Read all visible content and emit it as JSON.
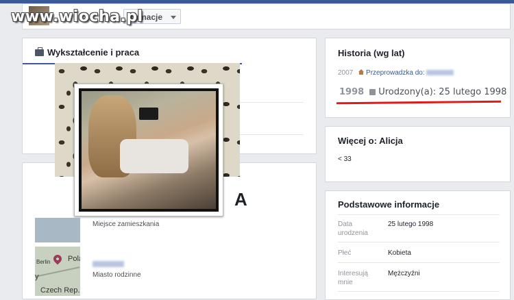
{
  "watermark": "www.wiocha.pl",
  "topbar": {
    "dropdown_label": "formacje"
  },
  "education": {
    "title": "Wykształcenie i praca",
    "overlay_letter": "A"
  },
  "places": [
    {
      "label": "Miejsce zamieszkania"
    },
    {
      "label": "Miasto rodzinne"
    }
  ],
  "map": {
    "label_berlin": "Berlin",
    "label_pola": "Pola",
    "label_y": "y",
    "label_czech": "Czech Rep."
  },
  "history": {
    "title": "Historia (wg lat)",
    "row1_year": "2007",
    "row1_text": "Przeprowadzka do:",
    "row2_year": "1998",
    "row2_text": "Urodzony(a): 25 lutego 1998",
    "highlight_color": "#e01919"
  },
  "more": {
    "title": "Więcej o: Alicja",
    "age": "< 33"
  },
  "basic": {
    "title": "Podstawowe informacje",
    "rows": [
      {
        "key": "Data urodzenia",
        "value": "25 lutego 1998"
      },
      {
        "key": "Płeć",
        "value": "Kobieta"
      },
      {
        "key": "Interesują mnie",
        "value": "Mężczyźni"
      }
    ]
  },
  "colors": {
    "facebook_blue": "#3b5998",
    "link": "#365899",
    "background": "#e9ebee"
  }
}
